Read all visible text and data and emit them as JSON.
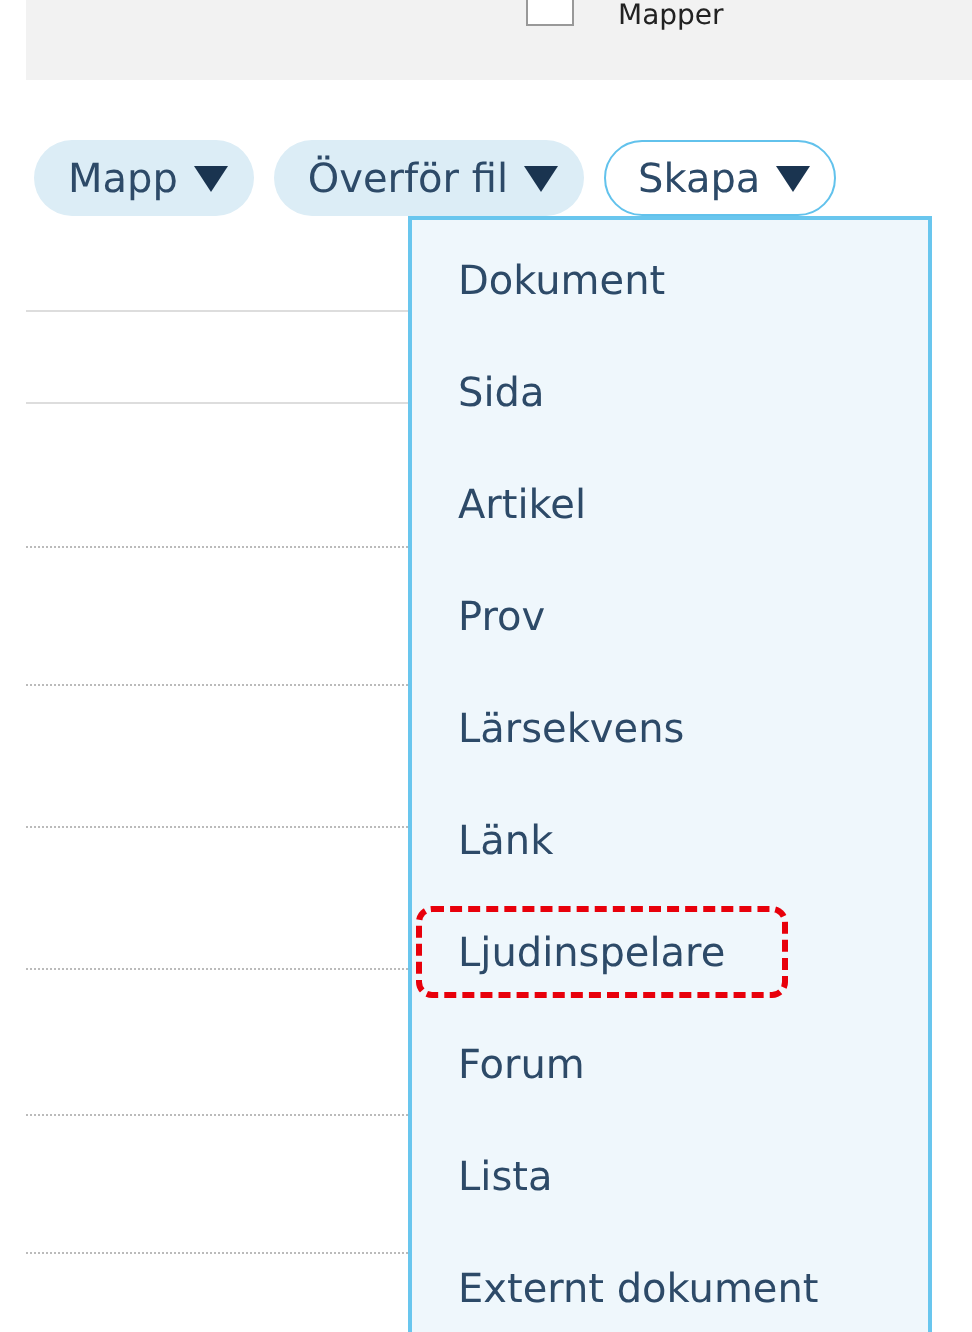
{
  "header": {
    "checkbox": {
      "checked": false
    },
    "label": "Mapper"
  },
  "toolbar": [
    {
      "label": "Mapp",
      "selected": false
    },
    {
      "label": "Överför fil",
      "selected": false
    },
    {
      "label": "Skapa",
      "selected": true
    }
  ],
  "dropdown_menu": [
    {
      "label": "Dokument",
      "highlighted": false
    },
    {
      "label": "Sida",
      "highlighted": false
    },
    {
      "label": "Artikel",
      "highlighted": false
    },
    {
      "label": "Prov",
      "highlighted": false
    },
    {
      "label": "Lärsekvens",
      "highlighted": false
    },
    {
      "label": "Länk",
      "highlighted": false
    },
    {
      "label": "Ljudinspelare",
      "highlighted": true
    },
    {
      "label": "Forum",
      "highlighted": false
    },
    {
      "label": "Lista",
      "highlighted": false
    },
    {
      "label": "Externt dokument",
      "highlighted": false
    }
  ]
}
